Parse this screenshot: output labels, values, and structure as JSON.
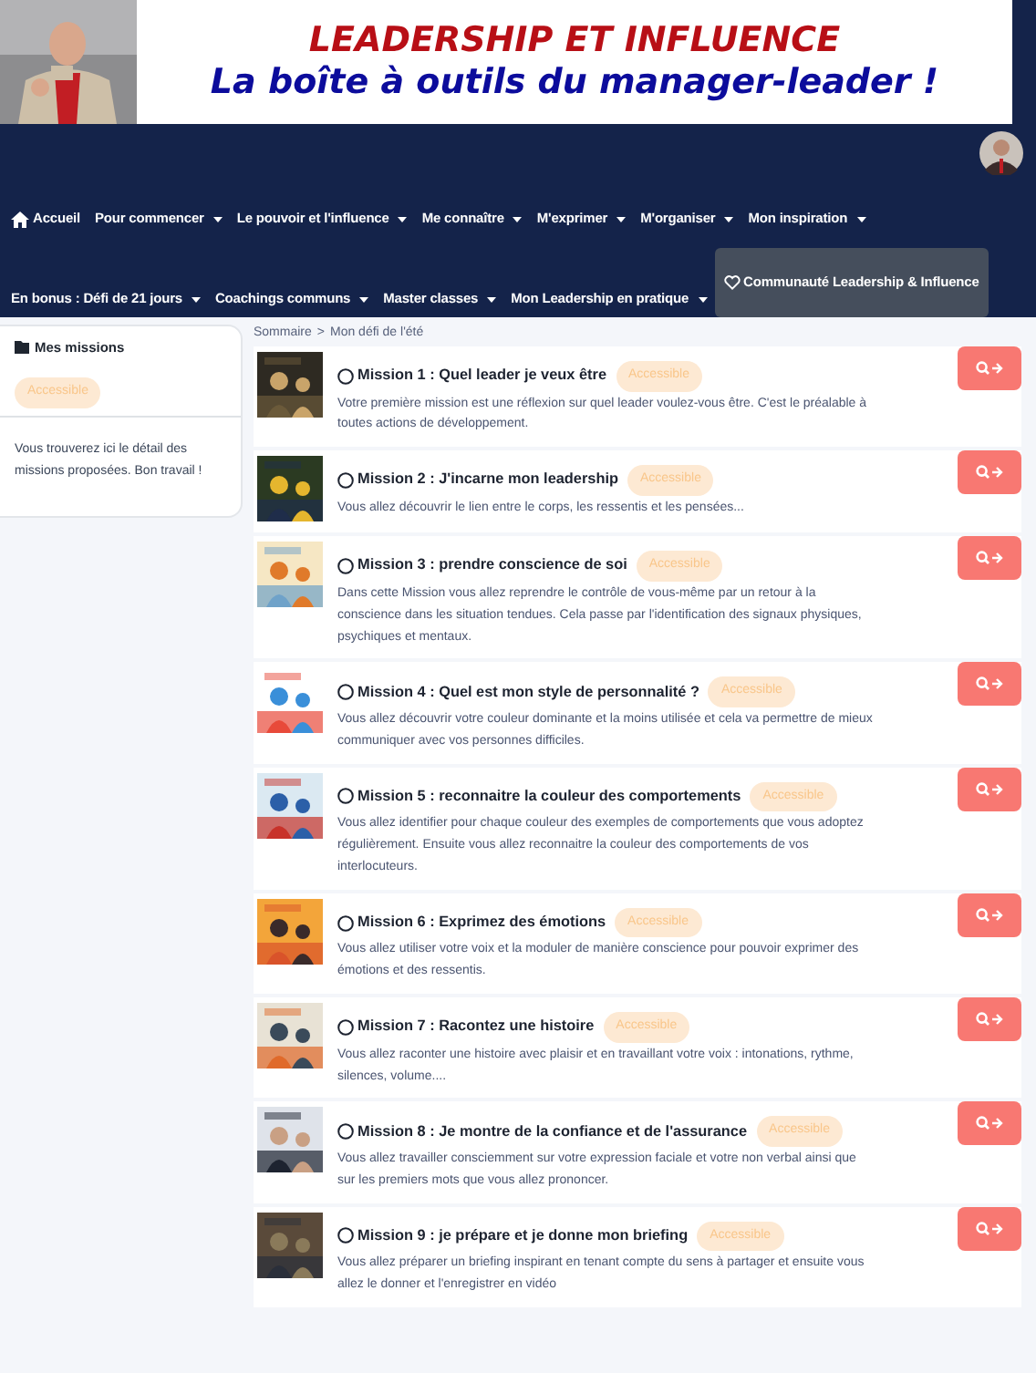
{
  "banner": {
    "title": "LEADERSHIP ET INFLUENCE",
    "subtitle": "La boîte à outils du manager-leader !"
  },
  "nav": {
    "menus": [
      {
        "items": [
          {
            "label": "Accueil",
            "kind": "home",
            "selected": false
          },
          {
            "label": "Pour commencer",
            "kind": "dropdown",
            "selected": false
          },
          {
            "label": "Le pouvoir et l'influence",
            "kind": "dropdown",
            "selected": false
          },
          {
            "label": "Me connaître",
            "kind": "dropdown",
            "selected": false
          },
          {
            "label": "M'exprimer",
            "kind": "dropdown",
            "selected": false
          },
          {
            "label": "M'organiser",
            "kind": "dropdown",
            "selected": false
          },
          {
            "label": "Mon inspiration",
            "kind": "dropdown",
            "selected": false
          }
        ]
      },
      {
        "items": [
          {
            "label": "En bonus : Défi de 21 jours",
            "kind": "dropdown",
            "selected": false
          },
          {
            "label": "Coachings communs",
            "kind": "dropdown",
            "selected": false
          },
          {
            "label": "Master classes",
            "kind": "dropdown",
            "selected": false
          },
          {
            "label": "Mon Leadership en pratique",
            "kind": "dropdown",
            "selected": false
          },
          {
            "label": "Communauté Leadership & Influence",
            "kind": "community",
            "selected": true
          }
        ]
      }
    ]
  },
  "sidebar": {
    "title": "Mes missions",
    "badge": "Accessible",
    "text": "Vous trouverez ici le détail des missions proposées. Bon travail !"
  },
  "breadcrumb": {
    "items": [
      "Sommaire",
      "Mon défi de l'été"
    ],
    "separator": ">"
  },
  "missions": [
    {
      "title": "Mission 1 : Quel leader je veux être",
      "badge": "Accessible",
      "done": false,
      "description": "Votre première mission est une réflexion sur quel leader voulez-vous être. C'est le préalable à toutes actions de développement."
    },
    {
      "title": "Mission 2 : J'incarne mon leadership",
      "badge": "Accessible",
      "done": false,
      "description": "Vous allez découvrir le lien entre le corps, les ressentis et les pensées..."
    },
    {
      "title": "Mission 3 : prendre conscience de soi",
      "badge": "Accessible",
      "done": false,
      "description": "Dans cette Mission vous allez reprendre le contrôle de vous-même par un retour à la conscience dans les situation tendues. Cela passe par l'identification des signaux physiques, psychiques et mentaux."
    },
    {
      "title": "Mission 4 : Quel est mon style de personnalité ?",
      "badge": "Accessible",
      "done": false,
      "description": "Vous allez découvrir votre couleur dominante et la moins utilisée et cela va permettre de mieux communiquer avec vos personnes difficiles."
    },
    {
      "title": "Mission 5 : reconnaitre la couleur des comportements",
      "badge": "Accessible",
      "done": false,
      "description": "Vous allez identifier pour chaque couleur des exemples de comportements que vous adoptez régulièrement. Ensuite vous allez reconnaitre la couleur des comportements de vos interlocuteurs."
    },
    {
      "title": "Mission 6 : Exprimez des émotions",
      "badge": "Accessible",
      "done": false,
      "description": "Vous allez utiliser votre voix et la moduler de manière conscience pour pouvoir exprimer des émotions et des ressentis."
    },
    {
      "title": "Mission 7 : Racontez une histoire",
      "badge": "Accessible",
      "done": false,
      "description": "Vous allez raconter une histoire avec plaisir et en travaillant votre voix : intonations, rythme, silences, volume...."
    },
    {
      "title": "Mission 8 : Je montre de la confiance et de l'assurance",
      "badge": "Accessible",
      "done": false,
      "description": "Vous allez travailler consciemment sur votre expression faciale et votre non verbal ainsi que sur les premiers mots que vous allez prononcer."
    },
    {
      "title": "Mission 9 : je prépare et je donne mon briefing",
      "badge": "Accessible",
      "done": false,
      "description": "Vous allez préparer un briefing inspirant en tenant compte du sens à partager et ensuite vous allez le donner et l'enregistrer en vidéo"
    }
  ]
}
